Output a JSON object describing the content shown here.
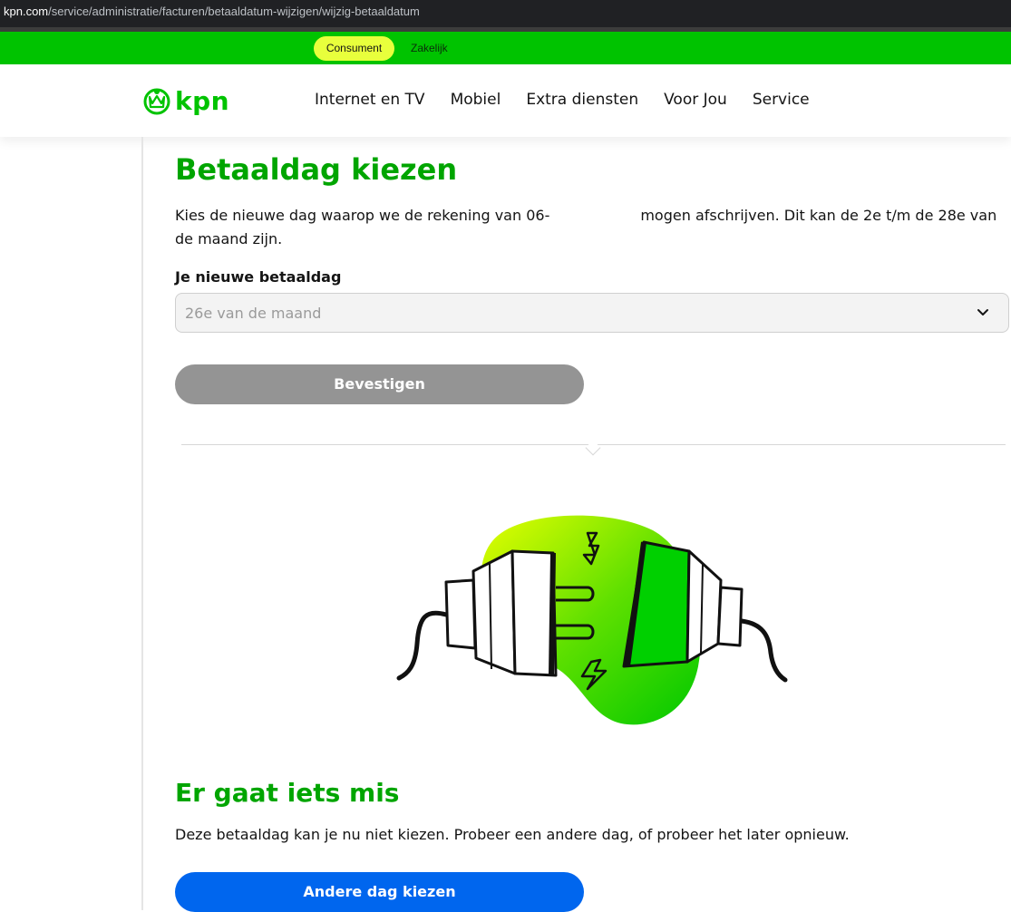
{
  "browser": {
    "url_host": "kpn.com",
    "url_path": "/service/administratie/facturen/betaaldatum-wijzigen/wijzig-betaaldatum"
  },
  "segments": {
    "consument": "Consument",
    "zakelijk": "Zakelijk"
  },
  "brand": {
    "logo_text": "kpn",
    "color_green": "#00c300",
    "color_accent_yellow": "#e8ff3c"
  },
  "nav": {
    "items": [
      "Internet en TV",
      "Mobiel",
      "Extra diensten",
      "Voor Jou",
      "Service"
    ]
  },
  "main": {
    "title": "Betaaldag kiezen",
    "intro_part1": "Kies de nieuwe dag waarop we de rekening van 06-",
    "intro_part2": "mogen afschrijven. Dit kan de 2e t/m de 28e van de maand zijn.",
    "field_label": "Je nieuwe betaaldag",
    "select_value": "26e van de maand",
    "confirm_button": "Bevestigen"
  },
  "error": {
    "illustration": "unplugged-power-plug-illustration",
    "title": "Er gaat iets mis",
    "text": "Deze betaaldag kan je nu niet kiezen. Probeer een andere dag, of probeer het later opnieuw.",
    "button": "Andere dag kiezen",
    "button_color": "#0066ee"
  }
}
